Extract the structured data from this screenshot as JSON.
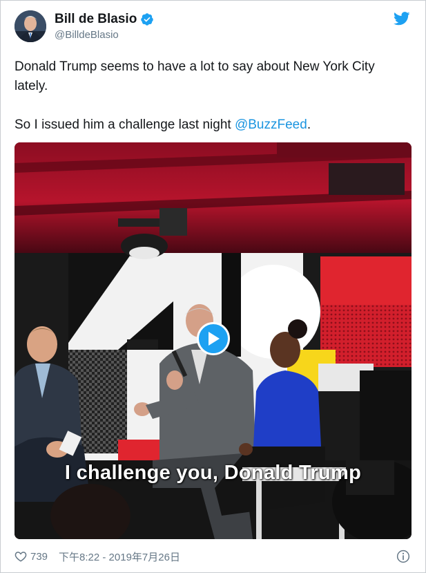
{
  "author": {
    "display_name": "Bill de Blasio",
    "handle": "@BilldeBlasio",
    "verified": true
  },
  "icons": {
    "verified": "verified-badge-icon",
    "brand": "twitter-bird-icon",
    "like": "heart-icon",
    "info": "info-icon",
    "play": "play-icon"
  },
  "tweet": {
    "line1": "Donald Trump seems to have a lot to say about New York City lately.",
    "line2_prefix": "So I issued him a challenge last night ",
    "mention": "@BuzzFeed",
    "line2_suffix": "."
  },
  "video": {
    "caption": "I challenge you, Donald Trump"
  },
  "footer": {
    "likes": "739",
    "timestamp": "下午8:22 - 2019年7月26日"
  },
  "colors": {
    "accent": "#1da1f2",
    "link": "#1b95e0",
    "muted": "#657786"
  }
}
